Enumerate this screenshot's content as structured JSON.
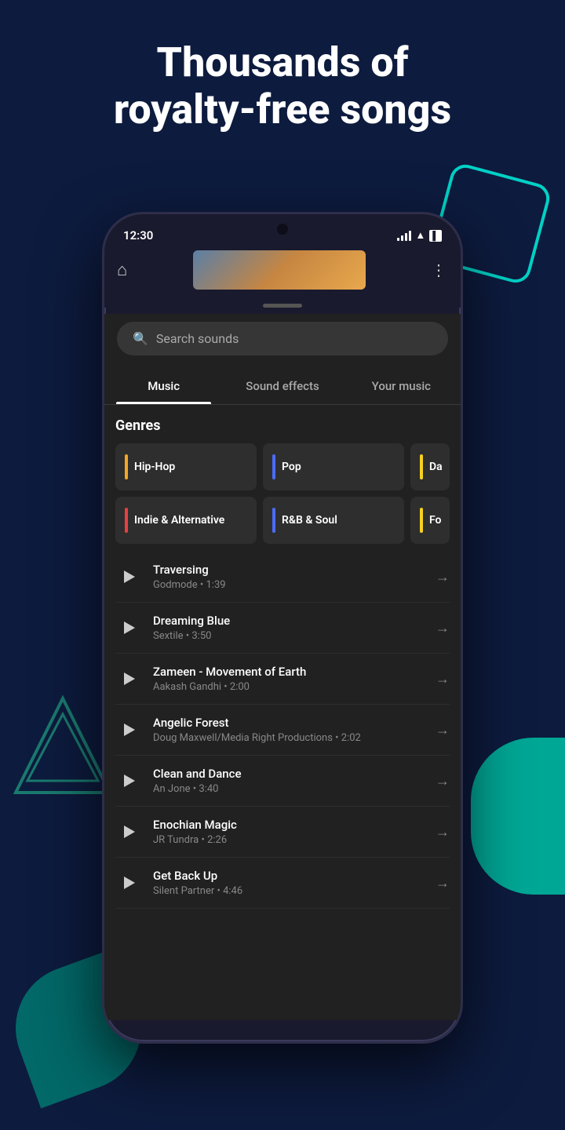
{
  "page": {
    "background_color": "#0d1b3e",
    "headline_line1": "Thousands of",
    "headline_line2": "royalty-free songs"
  },
  "status_bar": {
    "time": "12:30",
    "wifi": "▲▼",
    "battery": "🔋"
  },
  "app_header": {
    "home_icon": "⌂",
    "menu_icon": "⋮"
  },
  "search": {
    "placeholder": "Search sounds"
  },
  "tabs": [
    {
      "label": "Music",
      "active": true
    },
    {
      "label": "Sound effects",
      "active": false
    },
    {
      "label": "Your music",
      "active": false
    }
  ],
  "genres_title": "Genres",
  "genres": [
    {
      "label": "Hip-Hop",
      "accent_color": "#f5a623"
    },
    {
      "label": "Pop",
      "accent_color": "#4a6cf7"
    },
    {
      "label": "Da",
      "accent_color": "#f5d020",
      "partial": true
    },
    {
      "label": "Indie & Alternative",
      "accent_color": "#e84040"
    },
    {
      "label": "R&B & Soul",
      "accent_color": "#4a6cf7"
    },
    {
      "label": "Fo",
      "accent_color": "#f5d020",
      "partial": true
    }
  ],
  "tracks": [
    {
      "name": "Traversing",
      "artist": "Godmode",
      "duration": "1:39"
    },
    {
      "name": "Dreaming Blue",
      "artist": "Sextile",
      "duration": "3:50"
    },
    {
      "name": "Zameen - Movement of Earth",
      "artist": "Aakash Gandhi",
      "duration": "2:00"
    },
    {
      "name": "Angelic Forest",
      "artist": "Doug Maxwell/Media Right Productions",
      "duration": "2:02"
    },
    {
      "name": "Clean and Dance",
      "artist": "An Jone",
      "duration": "3:40"
    },
    {
      "name": "Enochian Magic",
      "artist": "JR Tundra",
      "duration": "2:26"
    },
    {
      "name": "Get Back Up",
      "artist": "Silent Partner",
      "duration": "4:46"
    }
  ]
}
